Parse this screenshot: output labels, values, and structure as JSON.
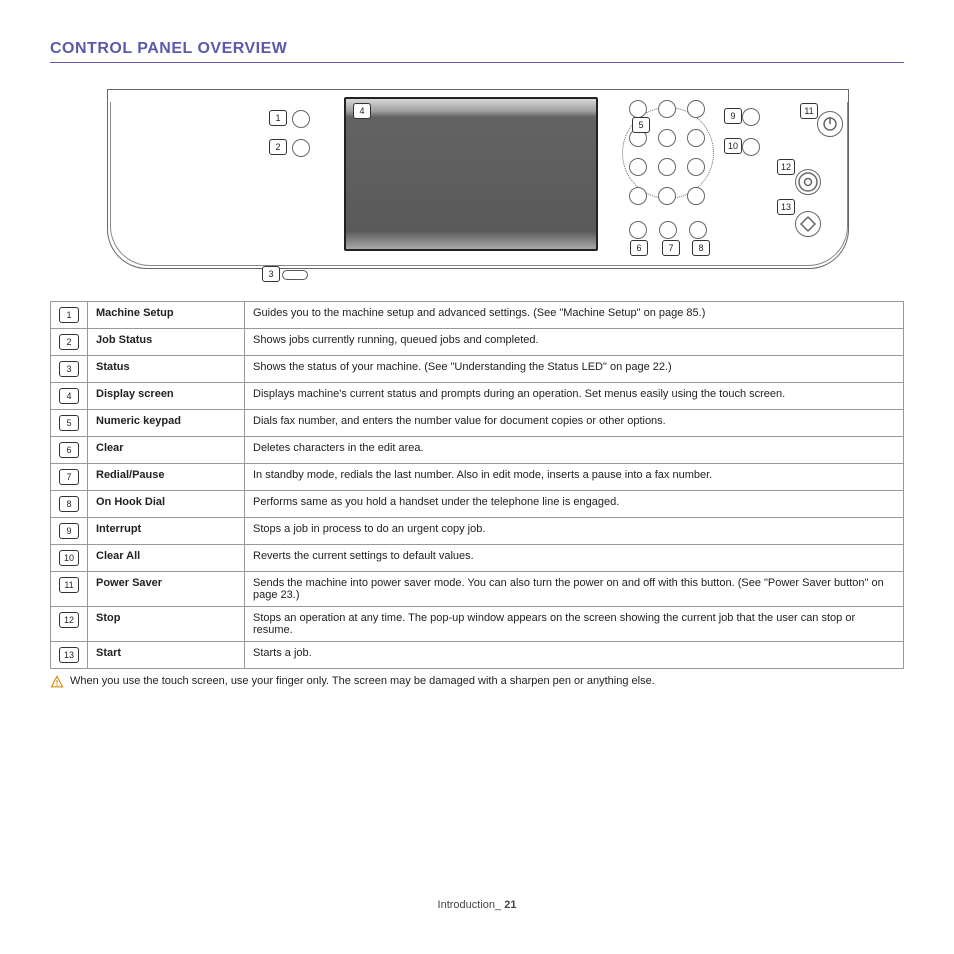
{
  "section_title": "CONTROL PANEL OVERVIEW",
  "diagram_callouts": [
    "1",
    "2",
    "3",
    "4",
    "5",
    "6",
    "7",
    "8",
    "9",
    "10",
    "11",
    "12",
    "13"
  ],
  "parts": [
    {
      "num": "1",
      "name": "Machine Setup",
      "desc": "Guides you to the machine setup and advanced settings. (See \"Machine Setup\" on page 85.)"
    },
    {
      "num": "2",
      "name": "Job Status",
      "desc": "Shows jobs currently running, queued jobs and completed."
    },
    {
      "num": "3",
      "name": "Status",
      "desc": "Shows the status of your machine. (See \"Understanding the Status LED\" on page 22.)"
    },
    {
      "num": "4",
      "name": "Display screen",
      "desc": "Displays machine's current status and prompts during an operation. Set menus easily using the touch screen."
    },
    {
      "num": "5",
      "name": "Numeric keypad",
      "desc": "Dials fax number, and enters the number value for document copies or other options."
    },
    {
      "num": "6",
      "name": "Clear",
      "desc": "Deletes characters in the edit area."
    },
    {
      "num": "7",
      "name": "Redial/Pause",
      "desc": "In standby mode, redials the last number. Also in edit mode, inserts a pause into a fax number."
    },
    {
      "num": "8",
      "name": "On Hook Dial",
      "desc": "Performs same as you hold a handset under the telephone line is engaged."
    },
    {
      "num": "9",
      "name": "Interrupt",
      "desc": "Stops a job in process to do an urgent copy job."
    },
    {
      "num": "10",
      "name": "Clear All",
      "desc": "Reverts the current settings to default values."
    },
    {
      "num": "11",
      "name": "Power Saver",
      "desc": "Sends the machine into power saver mode. You can also turn the power on and off with this button. (See \"Power Saver button\" on page 23.)"
    },
    {
      "num": "12",
      "name": "Stop",
      "desc": "Stops an operation at any time. The pop-up window appears on the screen showing the current job that the user can stop or resume."
    },
    {
      "num": "13",
      "name": "Start",
      "desc": "Starts a job."
    }
  ],
  "caution": "When you use the touch screen, use your finger only. The screen may be damaged with a sharpen pen or anything else.",
  "footer": {
    "chapter": "Introduction",
    "sep": "_",
    "page": "21"
  }
}
